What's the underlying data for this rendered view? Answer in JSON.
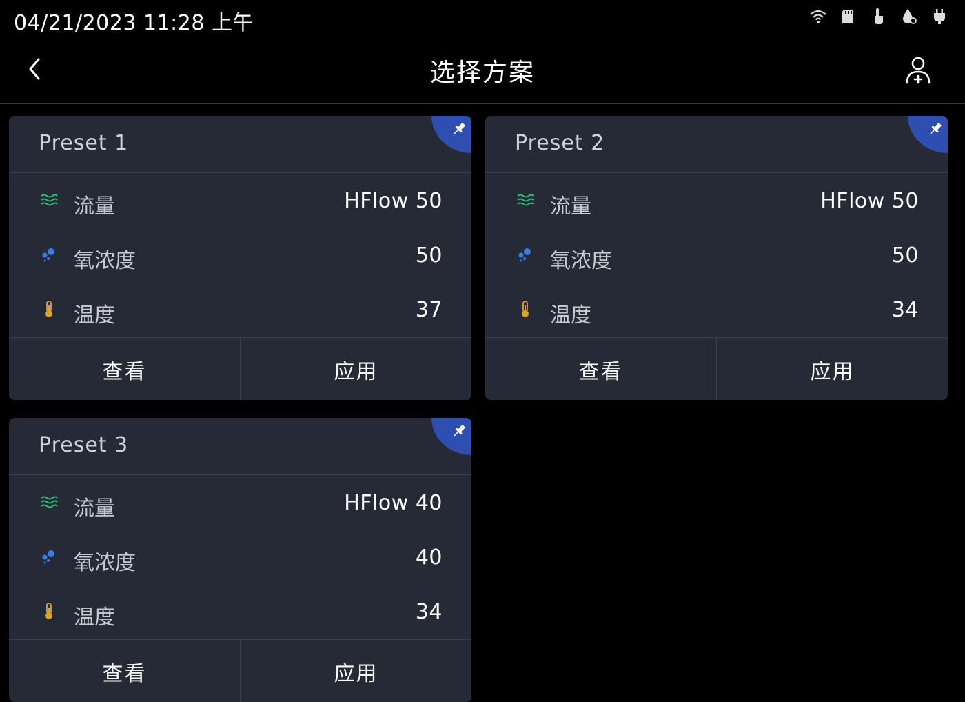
{
  "status_bar": {
    "datetime": "04/21/2023 11:28 上午",
    "icons": [
      "wifi-icon",
      "sd-card-icon",
      "touch-icon",
      "drop-icon",
      "plug-icon"
    ]
  },
  "header": {
    "title": "选择方案",
    "back_icon": "chevron-left-icon",
    "user_icon": "add-user-icon"
  },
  "labels": {
    "flow": "流量",
    "oxygen": "氧浓度",
    "temperature": "温度",
    "view": "查看",
    "apply": "应用"
  },
  "colors": {
    "flow_icon": "#2fbf71",
    "oxygen_icon": "#3c7be0",
    "temperature_icon": "#e0a030",
    "pin_corner": "#2e4fb0",
    "card_bg": "#262a36"
  },
  "presets": [
    {
      "name": "Preset 1",
      "flow": "HFlow 50",
      "oxygen": "50",
      "temperature": "37"
    },
    {
      "name": "Preset 2",
      "flow": "HFlow 50",
      "oxygen": "50",
      "temperature": "34"
    },
    {
      "name": "Preset 3",
      "flow": "HFlow 40",
      "oxygen": "40",
      "temperature": "34"
    }
  ]
}
